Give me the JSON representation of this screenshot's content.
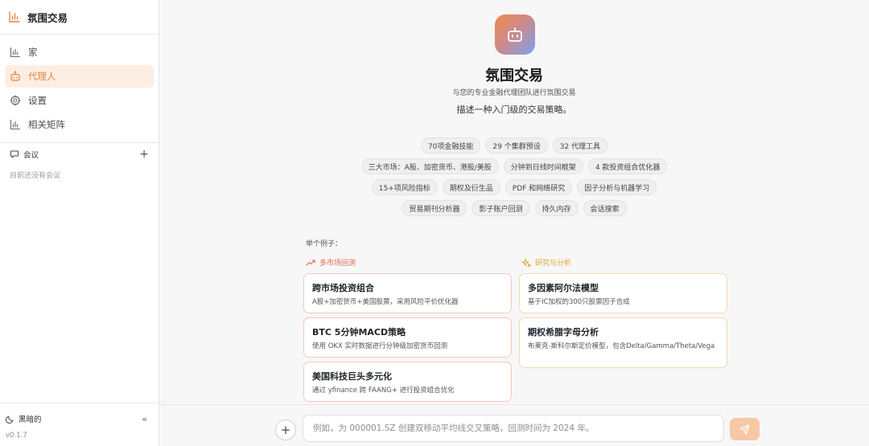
{
  "app": {
    "title": "氛围交易"
  },
  "sidebar": {
    "items": [
      {
        "label": "家",
        "icon": "bar-chart-icon"
      },
      {
        "label": "代理人",
        "icon": "robot-icon"
      },
      {
        "label": "设置",
        "icon": "gear-icon"
      },
      {
        "label": "相关矩阵",
        "icon": "bar-chart-icon"
      }
    ],
    "sessions_title": "会议",
    "sessions_empty": "目前还没有会议",
    "dark_mode_label": "黑暗的",
    "version": "v0.1.7"
  },
  "hero": {
    "title": "氛围交易",
    "subtitle": "与您的专业金融代理团队进行氛围交易",
    "description": "描述一种入门级的交易策略。"
  },
  "chips": [
    [
      "70项金融技能",
      "29 个集群预设",
      "32 代理工具"
    ],
    [
      "三大市场：A股、加密货币、港股/美股",
      "分钟到日线时间框架",
      "4 款投资组合优化器"
    ],
    [
      "15+项风险指标",
      "期权及衍生品",
      "PDF 和网络研究",
      "因子分析与机器学习"
    ],
    [
      "贸易期刊分析器",
      "影子账户回测",
      "持久内存",
      "会话搜索"
    ]
  ],
  "examples": {
    "label": "举个例子：",
    "categories": [
      {
        "label": "多市场回测",
        "icon": "trend-up-icon",
        "color": "#e36a4a"
      },
      {
        "label": "研究与分析",
        "icon": "sparkle-icon",
        "color": "#e0a52a"
      }
    ],
    "left_cards": [
      {
        "title": "跨市场投资组合",
        "desc": "A股+加密货币+美国股票，采用风险平价优化器"
      },
      {
        "title": "BTC 5分钟MACD策略",
        "desc": "使用 OKX 实时数据进行分钟级加密货币回测"
      },
      {
        "title": "美国科技巨头多元化",
        "desc": "通过 yfinance 跨 FAANG+ 进行投资组合优化"
      }
    ],
    "right_cards": [
      {
        "title": "多因素阿尔法模型",
        "desc": "基于IC加权的300只股票因子合成"
      },
      {
        "title": "期权希腊字母分析",
        "desc": "布莱克-斯科尔斯定价模型，包含Delta/Gamma/Theta/Vega"
      }
    ]
  },
  "composer": {
    "placeholder": "例如，为 000001.SZ 创建双移动平均线交叉策略，回测时间为 2024 年。"
  },
  "colors": {
    "accent": "#e7833f",
    "accent_light": "#fdeee3",
    "send": "#f8c7a6"
  }
}
